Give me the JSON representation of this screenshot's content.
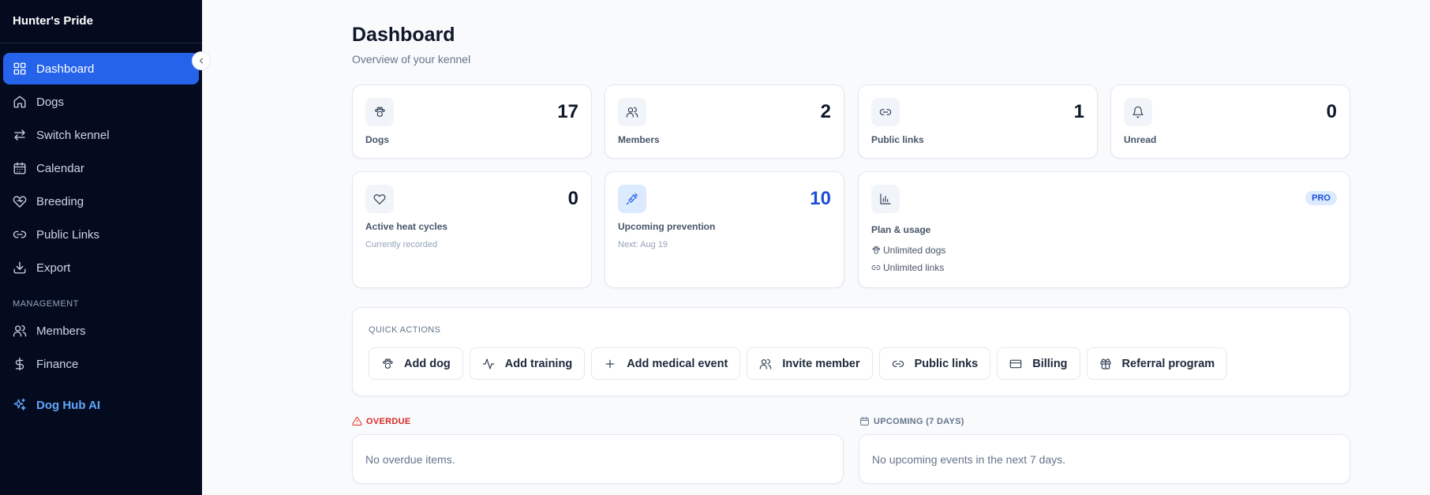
{
  "sidebar": {
    "brand": "Hunter's Pride",
    "items": [
      {
        "label": "Dashboard",
        "icon": "grid-icon"
      },
      {
        "label": "Dogs",
        "icon": "home-icon"
      },
      {
        "label": "Switch kennel",
        "icon": "switch-icon"
      },
      {
        "label": "Calendar",
        "icon": "calendar-icon"
      },
      {
        "label": "Breeding",
        "icon": "heart-icon"
      },
      {
        "label": "Public Links",
        "icon": "link-icon"
      },
      {
        "label": "Export",
        "icon": "download-icon"
      }
    ],
    "management_label": "MANAGEMENT",
    "management_items": [
      {
        "label": "Members",
        "icon": "users-icon"
      },
      {
        "label": "Finance",
        "icon": "dollar-icon"
      }
    ],
    "ai_label": "Dog Hub AI"
  },
  "header": {
    "title": "Dashboard",
    "subtitle": "Overview of your kennel"
  },
  "stats": {
    "dogs": {
      "value": "17",
      "label": "Dogs"
    },
    "members": {
      "value": "2",
      "label": "Members"
    },
    "public_links": {
      "value": "1",
      "label": "Public links"
    },
    "unread": {
      "value": "0",
      "label": "Unread"
    },
    "heat": {
      "value": "0",
      "label": "Active heat cycles",
      "sub": "Currently recorded"
    },
    "prevention": {
      "value": "10",
      "label": "Upcoming prevention",
      "sub": "Next: Aug 19"
    }
  },
  "plan": {
    "title": "Plan & usage",
    "badge": "PRO",
    "line1": "Unlimited dogs",
    "line2": "Unlimited links"
  },
  "quick_actions": {
    "title": "QUICK ACTIONS",
    "buttons": [
      {
        "label": "Add dog",
        "icon": "paw-icon"
      },
      {
        "label": "Add training",
        "icon": "activity-icon"
      },
      {
        "label": "Add medical event",
        "icon": "plus-icon"
      },
      {
        "label": "Invite member",
        "icon": "users-icon"
      },
      {
        "label": "Public links",
        "icon": "link-icon"
      },
      {
        "label": "Billing",
        "icon": "credit-card-icon"
      },
      {
        "label": "Referral program",
        "icon": "gift-icon"
      }
    ]
  },
  "overdue": {
    "title": "OVERDUE",
    "empty": "No overdue items."
  },
  "upcoming": {
    "title": "UPCOMING (7 DAYS)",
    "empty": "No upcoming events in the next 7 days."
  },
  "colors": {
    "accent": "#2563eb",
    "sidebar_bg": "#050b1f",
    "danger": "#dc2626"
  }
}
